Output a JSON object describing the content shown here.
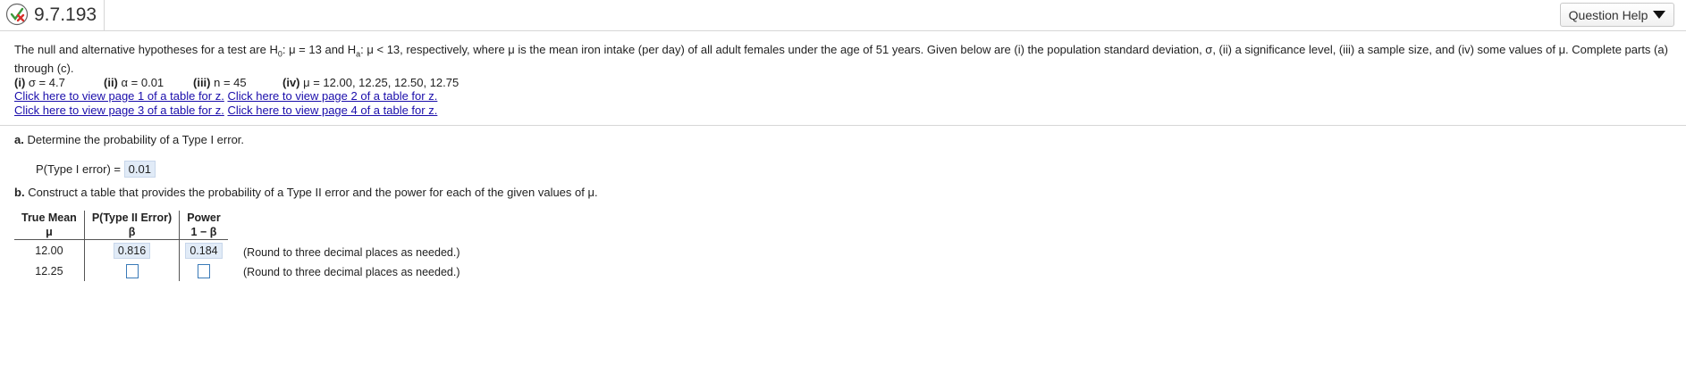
{
  "header": {
    "question_id": "9.7.193",
    "help_label": "Question Help"
  },
  "stem": {
    "part1": "The null and alternative hypotheses for a test are H",
    "h0_sub": "0",
    "part2": ": μ = 13 and H",
    "ha_sub": "a",
    "part3": ": μ < 13, respectively, where μ is the mean iron intake (per day) of all adult females under the age of 51 years. Given below are (i) the population standard deviation, σ, (ii) a significance level, (iii) a sample size, and (iv) some values of μ. Complete parts (a) through (c)."
  },
  "params": {
    "i_label": "(i)",
    "i_value": "σ = 4.7",
    "ii_label": "(ii)",
    "ii_value": "α = 0.01",
    "iii_label": "(iii)",
    "iii_value": "n = 45",
    "iv_label": "(iv)",
    "iv_value": "μ = 12.00, 12.25, 12.50, 12.75"
  },
  "links": {
    "page1": "Click here to view page 1 of a table for z.",
    "page2": "Click here to view page 2 of a table for z.",
    "page3": "Click here to view page 3 of a table for z.",
    "page4": "Click here to view page 4 of a table for z."
  },
  "part_a": {
    "label": "a.",
    "text": "Determine the probability of a Type I error.",
    "answer_label": "P(Type I error) =",
    "answer_value": "0.01"
  },
  "part_b": {
    "label": "b.",
    "text": "Construct a table that provides the probability of a Type II error and the power for each of the given values of μ."
  },
  "table": {
    "headers": [
      {
        "top": "True Mean",
        "bottom": "μ"
      },
      {
        "top": "P(Type II Error)",
        "bottom": "β"
      },
      {
        "top": "Power",
        "bottom": "1 − β"
      }
    ],
    "rows": [
      {
        "mean": "12.00",
        "beta": "0.816",
        "power": "0.184"
      },
      {
        "mean": "12.25",
        "beta": "",
        "power": ""
      }
    ],
    "round_note": "(Round to three decimal places as needed.)"
  },
  "colors": {
    "answer_bg": "#e1ebf7",
    "link": "#1a0dab",
    "status_icon_green": "#3a9a3a",
    "status_icon_red": "#d9302c"
  }
}
